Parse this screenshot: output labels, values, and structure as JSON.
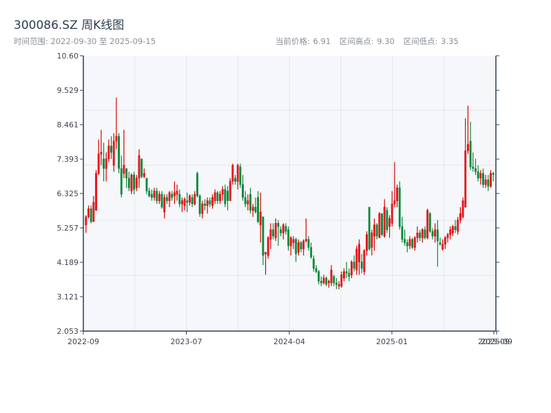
{
  "header": {
    "title": "300086.SZ 周K线图",
    "range_label": "时间范围: 2022-09-30 至 2025-09-15",
    "current_price": "当前价格: 6.91",
    "range_high": "区间高点: 9.30",
    "range_low": "区间低点: 3.35"
  },
  "chart_data": {
    "type": "candlestick",
    "title": "300086.SZ 周K线图",
    "period": "weekly",
    "start_date": "2022-09-30",
    "end_date": "2025-09-15",
    "ylim": [
      2.053,
      10.6
    ],
    "y_ticks": [
      "2.053",
      "3.121",
      "4.189",
      "5.257",
      "6.325",
      "7.393",
      "8.461",
      "9.529",
      "10.60"
    ],
    "x_ticks": [
      "2022-09",
      "2023-07",
      "2024-04",
      "2025-01",
      "2025-09",
      "2025-09"
    ],
    "grid": true,
    "colors": {
      "up": "#d40000",
      "up_fill": "#ee1c25",
      "down": "#08893a",
      "plot_bg": "#f5f7fa",
      "axis": "#2c3e50",
      "grid": "#e1e4ea"
    },
    "ohlc_columns": [
      "open",
      "high",
      "low",
      "close"
    ],
    "candles": [
      [
        5.35,
        5.65,
        5.1,
        5.6
      ],
      [
        5.6,
        5.95,
        5.55,
        5.85
      ],
      [
        5.85,
        5.95,
        5.4,
        5.45
      ],
      [
        5.45,
        6.25,
        5.45,
        6.05
      ],
      [
        5.8,
        7.05,
        5.8,
        6.95
      ],
      [
        6.95,
        8.0,
        6.9,
        7.55
      ],
      [
        7.55,
        8.3,
        7.2,
        7.6
      ],
      [
        7.4,
        7.9,
        6.7,
        7.1
      ],
      [
        7.1,
        7.6,
        6.7,
        7.4
      ],
      [
        7.4,
        8.0,
        7.3,
        7.8
      ],
      [
        7.8,
        8.1,
        7.4,
        7.6
      ],
      [
        7.2,
        8.2,
        7.0,
        7.95
      ],
      [
        7.95,
        9.3,
        7.7,
        8.1
      ],
      [
        8.1,
        8.2,
        6.95,
        7.1
      ],
      [
        7.1,
        7.5,
        6.2,
        6.3
      ],
      [
        6.95,
        8.3,
        6.8,
        7.2
      ],
      [
        7.1,
        7.1,
        6.5,
        6.8
      ],
      [
        6.8,
        7.0,
        6.4,
        6.5
      ],
      [
        6.4,
        6.95,
        6.3,
        6.9
      ],
      [
        6.9,
        7.0,
        6.3,
        6.45
      ],
      [
        6.5,
        6.9,
        6.4,
        6.8
      ],
      [
        6.8,
        7.7,
        6.5,
        7.5
      ],
      [
        7.4,
        7.4,
        6.8,
        6.85
      ],
      [
        6.85,
        7.1,
        6.8,
        6.95
      ],
      [
        6.8,
        6.8,
        6.3,
        6.4
      ],
      [
        6.4,
        6.5,
        6.2,
        6.25
      ],
      [
        6.3,
        6.45,
        6.1,
        6.2
      ],
      [
        6.2,
        6.5,
        6.1,
        6.4
      ],
      [
        6.4,
        6.5,
        6.0,
        6.1
      ],
      [
        6.1,
        6.4,
        6.0,
        6.3
      ],
      [
        6.3,
        6.4,
        5.85,
        5.9
      ],
      [
        5.75,
        6.3,
        5.55,
        6.2
      ],
      [
        6.2,
        6.3,
        6.0,
        6.1
      ],
      [
        6.1,
        6.4,
        5.9,
        6.35
      ],
      [
        6.3,
        6.4,
        6.1,
        6.2
      ],
      [
        6.25,
        6.7,
        6.0,
        6.35
      ],
      [
        6.3,
        6.6,
        6.1,
        6.4
      ],
      [
        6.3,
        6.45,
        5.9,
        6.0
      ],
      [
        6.0,
        6.2,
        5.75,
        6.1
      ],
      [
        5.95,
        6.2,
        5.8,
        6.15
      ],
      [
        6.1,
        6.35,
        5.75,
        6.05
      ],
      [
        6.05,
        6.3,
        5.95,
        6.25
      ],
      [
        6.2,
        6.3,
        5.9,
        6.0
      ],
      [
        6.0,
        6.4,
        5.95,
        6.3
      ],
      [
        6.95,
        7.0,
        6.2,
        6.25
      ],
      [
        6.25,
        6.3,
        5.6,
        5.7
      ],
      [
        5.7,
        6.1,
        5.55,
        6.0
      ],
      [
        6.0,
        6.15,
        5.8,
        5.95
      ],
      [
        5.95,
        6.2,
        5.7,
        6.1
      ],
      [
        6.1,
        6.2,
        5.9,
        6.0
      ],
      [
        5.95,
        6.3,
        5.85,
        6.2
      ],
      [
        6.1,
        6.45,
        6.0,
        6.35
      ],
      [
        6.35,
        6.4,
        6.0,
        6.1
      ],
      [
        6.1,
        6.4,
        6.0,
        6.3
      ],
      [
        6.3,
        6.55,
        6.1,
        6.45
      ],
      [
        6.45,
        6.6,
        5.9,
        6.0
      ],
      [
        6.4,
        6.55,
        5.8,
        6.1
      ],
      [
        6.1,
        6.8,
        6.1,
        6.7
      ],
      [
        6.7,
        7.25,
        6.6,
        7.2
      ],
      [
        6.8,
        6.9,
        6.6,
        6.7
      ],
      [
        6.7,
        7.25,
        6.45,
        7.2
      ],
      [
        7.15,
        7.25,
        6.5,
        6.6
      ],
      [
        6.6,
        6.9,
        6.1,
        6.2
      ],
      [
        6.2,
        6.4,
        5.9,
        6.0
      ],
      [
        6.0,
        6.3,
        5.8,
        6.1
      ],
      [
        6.3,
        6.5,
        5.7,
        5.8
      ],
      [
        5.8,
        6.0,
        5.6,
        5.9
      ],
      [
        5.9,
        6.2,
        5.7,
        5.75
      ],
      [
        6.2,
        6.4,
        5.4,
        5.45
      ],
      [
        5.35,
        6.35,
        4.8,
        5.75
      ],
      [
        5.6,
        5.6,
        4.1,
        4.4
      ],
      [
        4.45,
        4.5,
        3.8,
        4.5
      ],
      [
        4.4,
        5.0,
        4.3,
        4.95
      ],
      [
        4.9,
        5.4,
        4.6,
        5.2
      ],
      [
        5.2,
        5.4,
        4.9,
        5.0
      ],
      [
        4.95,
        5.55,
        4.85,
        5.4
      ],
      [
        5.4,
        5.5,
        4.7,
        5.3
      ],
      [
        5.2,
        5.3,
        5.0,
        5.1
      ],
      [
        5.1,
        5.4,
        4.9,
        5.35
      ],
      [
        5.3,
        5.4,
        5.05,
        5.15
      ],
      [
        5.2,
        5.3,
        4.55,
        4.7
      ],
      [
        4.7,
        5.0,
        4.4,
        4.95
      ],
      [
        4.8,
        5.0,
        4.6,
        4.9
      ],
      [
        4.9,
        4.95,
        4.2,
        4.45
      ],
      [
        4.5,
        4.9,
        4.4,
        4.8
      ],
      [
        4.8,
        4.85,
        4.5,
        4.6
      ],
      [
        4.6,
        4.9,
        4.4,
        4.85
      ],
      [
        4.85,
        5.55,
        4.8,
        4.9
      ],
      [
        4.9,
        5.0,
        4.55,
        4.65
      ],
      [
        4.65,
        4.8,
        4.3,
        4.35
      ],
      [
        4.3,
        4.4,
        3.9,
        4.0
      ],
      [
        4.0,
        4.1,
        3.85,
        3.9
      ],
      [
        3.9,
        3.95,
        3.5,
        3.6
      ],
      [
        3.6,
        3.75,
        3.45,
        3.55
      ],
      [
        3.55,
        3.8,
        3.5,
        3.7
      ],
      [
        3.7,
        3.75,
        3.45,
        3.5
      ],
      [
        3.55,
        3.65,
        3.4,
        3.6
      ],
      [
        3.55,
        4.1,
        3.45,
        3.95
      ],
      [
        3.75,
        3.8,
        3.45,
        3.55
      ],
      [
        3.55,
        3.7,
        3.35,
        3.5
      ],
      [
        3.45,
        3.6,
        3.35,
        3.5
      ],
      [
        3.45,
        3.9,
        3.4,
        3.8
      ],
      [
        3.7,
        4.0,
        3.6,
        3.9
      ],
      [
        3.9,
        4.2,
        3.7,
        3.85
      ],
      [
        3.85,
        4.0,
        3.6,
        3.75
      ],
      [
        3.8,
        4.25,
        3.7,
        4.2
      ],
      [
        4.2,
        4.4,
        3.9,
        4.0
      ],
      [
        3.95,
        4.7,
        3.8,
        4.6
      ],
      [
        4.2,
        4.9,
        3.8,
        4.75
      ],
      [
        4.2,
        4.45,
        3.85,
        4.0
      ],
      [
        3.9,
        4.6,
        3.8,
        4.55
      ],
      [
        4.55,
        5.15,
        4.4,
        5.05
      ],
      [
        5.9,
        5.9,
        4.55,
        4.6
      ],
      [
        4.65,
        5.2,
        4.4,
        5.1
      ],
      [
        5.0,
        5.55,
        4.55,
        5.35
      ],
      [
        5.35,
        5.4,
        4.9,
        5.0
      ],
      [
        4.95,
        5.75,
        4.95,
        5.7
      ],
      [
        5.7,
        5.7,
        5.0,
        5.05
      ],
      [
        5.0,
        6.15,
        4.95,
        5.9
      ],
      [
        5.8,
        5.9,
        5.1,
        5.2
      ],
      [
        5.3,
        5.65,
        4.95,
        5.55
      ],
      [
        5.4,
        6.4,
        5.3,
        6.0
      ],
      [
        6.0,
        7.3,
        5.9,
        6.1
      ],
      [
        6.1,
        6.6,
        5.9,
        6.5
      ],
      [
        6.5,
        6.7,
        5.2,
        5.3
      ],
      [
        5.3,
        5.6,
        4.8,
        4.9
      ],
      [
        4.9,
        5.2,
        4.7,
        4.8
      ],
      [
        4.8,
        4.9,
        4.5,
        4.7
      ],
      [
        4.7,
        5.0,
        4.6,
        4.9
      ],
      [
        4.9,
        4.95,
        4.6,
        4.65
      ],
      [
        4.65,
        5.0,
        4.55,
        4.95
      ],
      [
        4.95,
        5.3,
        4.8,
        5.1
      ],
      [
        5.1,
        5.2,
        4.85,
        4.95
      ],
      [
        4.95,
        5.25,
        4.8,
        5.2
      ],
      [
        5.2,
        5.3,
        4.9,
        4.95
      ],
      [
        4.95,
        5.85,
        4.9,
        5.8
      ],
      [
        5.7,
        5.75,
        5.1,
        5.15
      ],
      [
        5.15,
        5.25,
        4.9,
        5.0
      ],
      [
        5.0,
        5.4,
        4.8,
        5.2
      ],
      [
        5.2,
        5.5,
        4.05,
        4.85
      ],
      [
        4.8,
        4.95,
        4.7,
        4.75
      ],
      [
        4.6,
        4.9,
        4.55,
        4.75
      ],
      [
        4.75,
        5.0,
        4.6,
        4.95
      ],
      [
        4.95,
        5.1,
        4.8,
        5.05
      ],
      [
        5.05,
        5.3,
        4.9,
        5.2
      ],
      [
        5.1,
        5.35,
        5.0,
        5.3
      ],
      [
        5.3,
        5.5,
        5.1,
        5.2
      ],
      [
        5.15,
        5.6,
        5.05,
        5.5
      ],
      [
        5.5,
        5.9,
        5.4,
        5.7
      ],
      [
        5.6,
        6.2,
        5.55,
        6.1
      ],
      [
        5.9,
        8.66,
        5.9,
        7.65
      ],
      [
        7.65,
        9.05,
        7.55,
        7.85
      ],
      [
        7.95,
        8.55,
        7.05,
        7.15
      ],
      [
        7.15,
        7.6,
        7.0,
        7.1
      ],
      [
        7.1,
        7.4,
        6.9,
        7.0
      ],
      [
        7.0,
        7.2,
        6.7,
        6.8
      ],
      [
        6.8,
        7.05,
        6.6,
        6.95
      ],
      [
        6.95,
        7.1,
        6.5,
        6.6
      ],
      [
        6.6,
        6.9,
        6.5,
        6.75
      ],
      [
        6.75,
        6.9,
        6.4,
        6.55
      ],
      [
        6.55,
        7.05,
        6.5,
        6.95
      ],
      [
        6.95,
        7.0,
        6.7,
        6.91
      ]
    ]
  }
}
